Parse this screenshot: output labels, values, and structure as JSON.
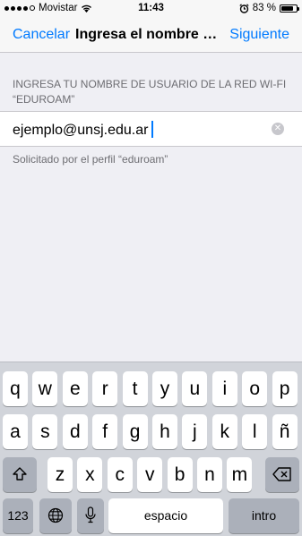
{
  "status_bar": {
    "carrier": "Movistar",
    "time": "11:43",
    "battery_text": "83 %",
    "battery_level": 0.83,
    "icons": [
      "signal-icon",
      "wifi-icon",
      "alarm-icon",
      "battery-icon"
    ]
  },
  "nav": {
    "left_label": "Cancelar",
    "title": "Ingresa el nombre de usuario",
    "right_label": "Siguiente",
    "accent_color": "#007aff"
  },
  "form": {
    "section_header": "INGRESA TU NOMBRE DE USUARIO DE LA RED WI-FI “EDUROAM”",
    "username_value": "ejemplo@unsj.edu.ar",
    "clear_icon": "clear-icon",
    "footer_note": "Solicitado por el perfil “eduroam”"
  },
  "keyboard": {
    "row1": [
      "q",
      "w",
      "e",
      "r",
      "t",
      "y",
      "u",
      "i",
      "o",
      "p"
    ],
    "row2": [
      "a",
      "s",
      "d",
      "f",
      "g",
      "h",
      "j",
      "k",
      "l",
      "ñ"
    ],
    "row3": [
      "z",
      "x",
      "c",
      "v",
      "b",
      "n",
      "m"
    ],
    "shift_icon": "shift-icon",
    "delete_icon": "delete-icon",
    "numbers_label": "123",
    "globe_icon": "globe-icon",
    "mic_icon": "microphone-icon",
    "space_label": "espacio",
    "return_label": "intro"
  }
}
